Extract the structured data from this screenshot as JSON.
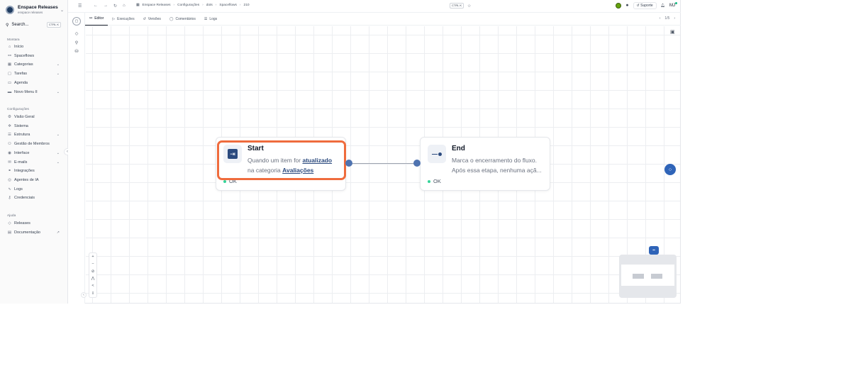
{
  "workspace": {
    "name": "Enspace Releases",
    "subtitle": "enspace releases"
  },
  "search": {
    "label": "Search...",
    "shortcut": "CTRL K"
  },
  "sidebar": {
    "section_montara": "Montara",
    "montara_items": [
      {
        "label": "Início",
        "icon": "home-icon",
        "chev": ""
      },
      {
        "label": "Spaceflows",
        "icon": "flow-icon",
        "chev": ""
      },
      {
        "label": "Categorias",
        "icon": "grid-icon",
        "chev": "⌄"
      },
      {
        "label": "Tarefas",
        "icon": "doc-icon",
        "chev": "⌄"
      },
      {
        "label": "Agenda",
        "icon": "calendar-icon",
        "chev": ""
      },
      {
        "label": "Novo Menu II",
        "icon": "menu-icon",
        "chev": "⌄"
      }
    ],
    "section_config": "Configurações",
    "config_items": [
      {
        "label": "Visão Geral",
        "icon": "gear-icon",
        "chev": ""
      },
      {
        "label": "Sistema",
        "icon": "cog-icon",
        "chev": ""
      },
      {
        "label": "Estrutura",
        "icon": "structure-icon",
        "chev": "⌄"
      },
      {
        "label": "Gestão de Membros",
        "icon": "users-icon",
        "chev": ""
      },
      {
        "label": "Interface",
        "icon": "palette-icon",
        "chev": "⌄"
      },
      {
        "label": "E-mails",
        "icon": "mail-icon",
        "chev": "⌄"
      },
      {
        "label": "Integrações",
        "icon": "plug-icon",
        "chev": ""
      },
      {
        "label": "Agentes de IA",
        "icon": "bot-icon",
        "chev": ""
      },
      {
        "label": "Logs",
        "icon": "activity-icon",
        "chev": ""
      },
      {
        "label": "Credenciais",
        "icon": "key-icon",
        "chev": ""
      }
    ],
    "section_ajuda": "Ajuda",
    "ajuda_items": [
      {
        "label": "Releases",
        "icon": "tag-icon",
        "chev": ""
      },
      {
        "label": "Documentação",
        "icon": "book-icon",
        "chev": "↗"
      }
    ]
  },
  "breadcrumb": [
    "Enspace Releases",
    "Configurações",
    "dots",
    "Spaceflows",
    "210"
  ],
  "topbar": {
    "shortcut": "CTRL K",
    "support": "Suporte",
    "user_initials": "MJ"
  },
  "tabs": [
    "Editor",
    "Execuções",
    "Versões",
    "Comentários",
    "Logs"
  ],
  "pagination": "1/5",
  "nodes": {
    "start": {
      "title": "Start",
      "desc_prefix": "Quando um item for",
      "desc_bold": "atualizado",
      "desc_line2_prefix": "na categoria",
      "desc_line2_bold": "Avaliações",
      "status": "OK"
    },
    "end": {
      "title": "End",
      "desc_line1": "Marca o encerramento do fluxo.",
      "desc_line2": "Após essa etapa, nenhuma açã...",
      "status": "OK"
    }
  },
  "colors": {
    "highlight": "#ef6c3d",
    "accent": "#2f64b8",
    "ok": "#34d399"
  }
}
